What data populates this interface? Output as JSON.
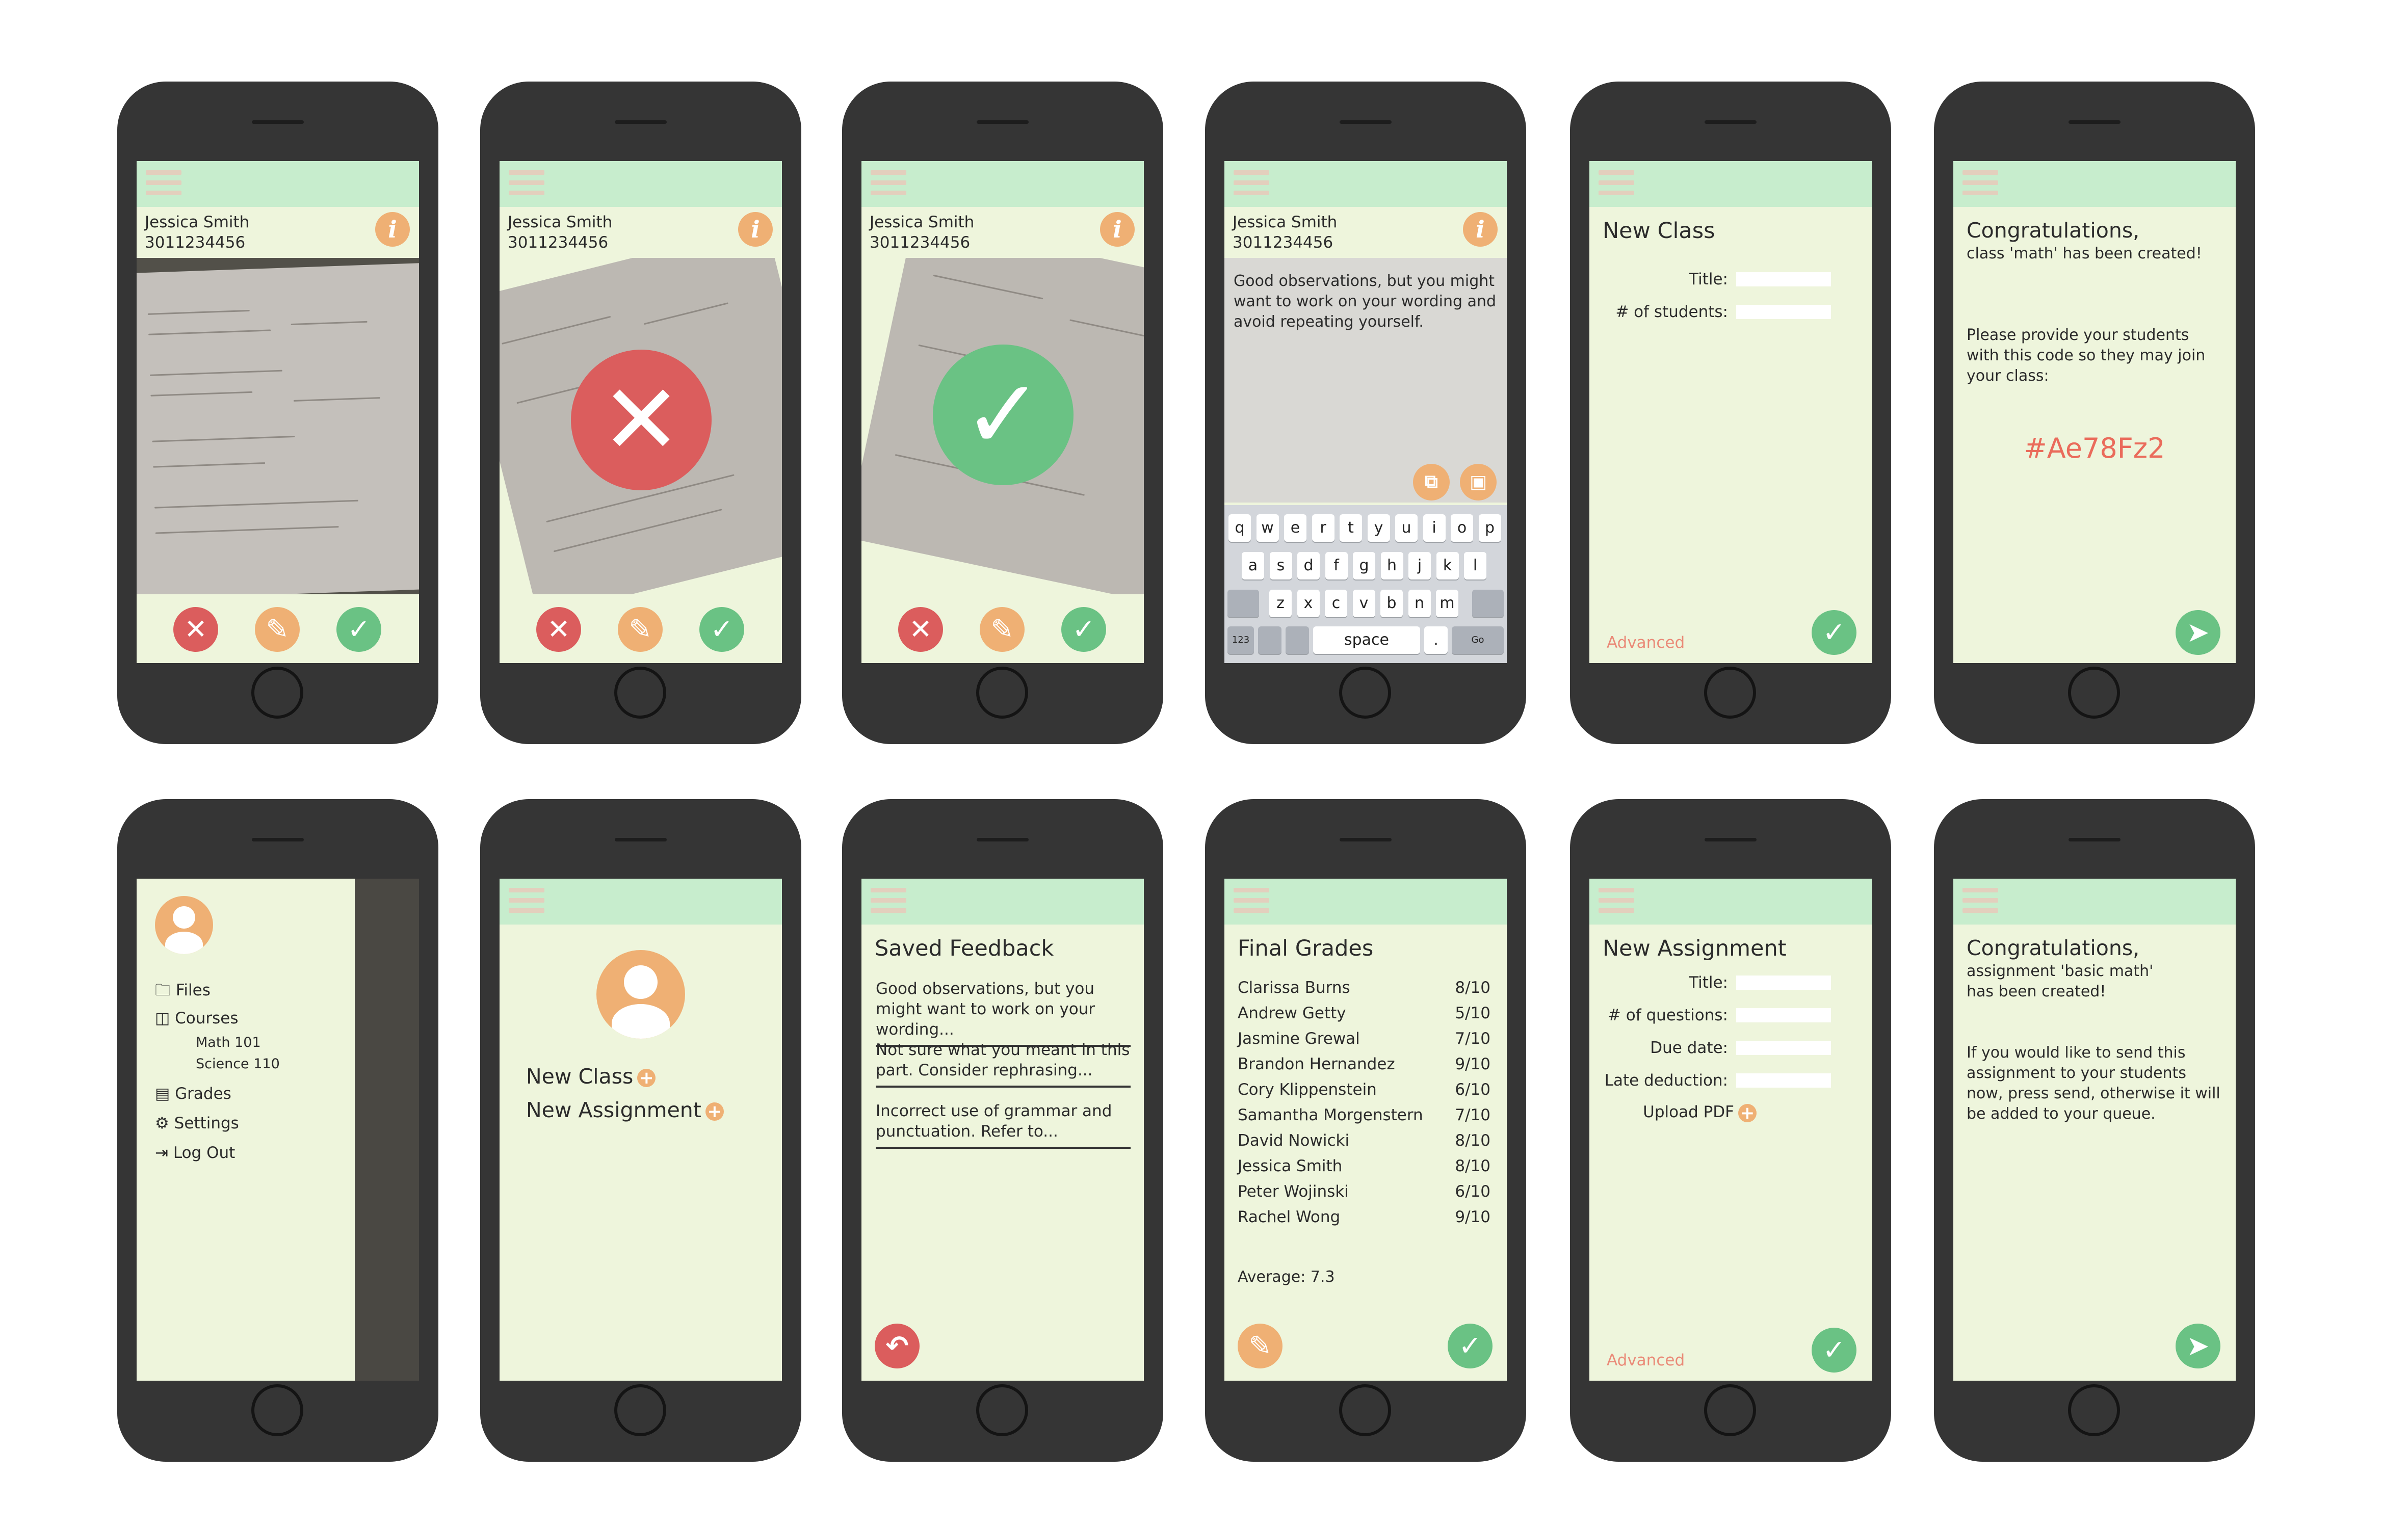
{
  "colors": {
    "topbar": "#c7edcd",
    "screen": "#eef5dc",
    "phone": "#353535",
    "orange": "#efb074",
    "red": "#db5d5d",
    "green": "#6ac284",
    "code": "#ea6b5b"
  },
  "review": {
    "student_name": "Jessica Smith",
    "student_id": "3011234456",
    "info_glyph": "i"
  },
  "feedback_editor": {
    "text": "Good observations, but you might want to work on your wording and avoid repeating yourself.",
    "keyboard": {
      "row1": [
        "q",
        "w",
        "e",
        "r",
        "t",
        "y",
        "u",
        "i",
        "o",
        "p"
      ],
      "row2": [
        "a",
        "s",
        "d",
        "f",
        "g",
        "h",
        "j",
        "k",
        "l"
      ],
      "row3": [
        "z",
        "x",
        "c",
        "v",
        "b",
        "n",
        "m"
      ],
      "numbers_key": "123",
      "space_key": "space",
      "dot_key": ".",
      "go_key": "Go"
    }
  },
  "new_class": {
    "title": "New Class",
    "title_label": "Title:",
    "students_label": "# of students:",
    "advanced": "Advanced"
  },
  "class_created": {
    "heading": "Congratulations,",
    "subheading": "class 'math' has been created!",
    "instructions": "Please provide your students with this code so they may join your class:",
    "code": "#Ae78Fz2"
  },
  "drawer": {
    "items": [
      {
        "label": "Files",
        "icon": "folder-icon"
      },
      {
        "label": "Courses",
        "icon": "book-icon"
      },
      {
        "label": "Grades",
        "icon": "document-icon"
      },
      {
        "label": "Settings",
        "icon": "gear-icon"
      },
      {
        "label": "Log Out",
        "icon": "logout-icon"
      }
    ],
    "courses": [
      "Math 101",
      "Science 110"
    ]
  },
  "home": {
    "new_class": "New Class",
    "new_assignment": "New Assignment"
  },
  "saved_feedback": {
    "title": "Saved Feedback",
    "items": [
      "Good observations, but you might want to work on your wording...",
      "Not sure what you meant in this part. Consider rephrasing...",
      "Incorrect use of grammar and punctuation. Refer to..."
    ]
  },
  "final_grades": {
    "title": "Final Grades",
    "rows": [
      {
        "name": "Clarissa Burns",
        "grade": "8/10"
      },
      {
        "name": "Andrew Getty",
        "grade": "5/10"
      },
      {
        "name": "Jasmine Grewal",
        "grade": "7/10"
      },
      {
        "name": "Brandon Hernandez",
        "grade": "9/10"
      },
      {
        "name": "Cory Klippenstein",
        "grade": "6/10"
      },
      {
        "name": "Samantha Morgenstern",
        "grade": "7/10"
      },
      {
        "name": "David Nowicki",
        "grade": "8/10"
      },
      {
        "name": "Jessica Smith",
        "grade": "8/10"
      },
      {
        "name": "Peter Wojinski",
        "grade": "6/10"
      },
      {
        "name": "Rachel Wong",
        "grade": "9/10"
      }
    ],
    "average": "Average: 7.3"
  },
  "new_assignment": {
    "title": "New Assignment",
    "title_label": "Title:",
    "questions_label": "# of questions:",
    "due_label": "Due date:",
    "late_label": "Late deduction:",
    "upload_label": "Upload PDF",
    "advanced": "Advanced"
  },
  "assignment_created": {
    "heading": "Congratulations,",
    "subheading": "assignment 'basic math' has been created!",
    "instructions": "If you would like to send this assignment to your students now, press send, otherwise it will be added to your queue."
  }
}
